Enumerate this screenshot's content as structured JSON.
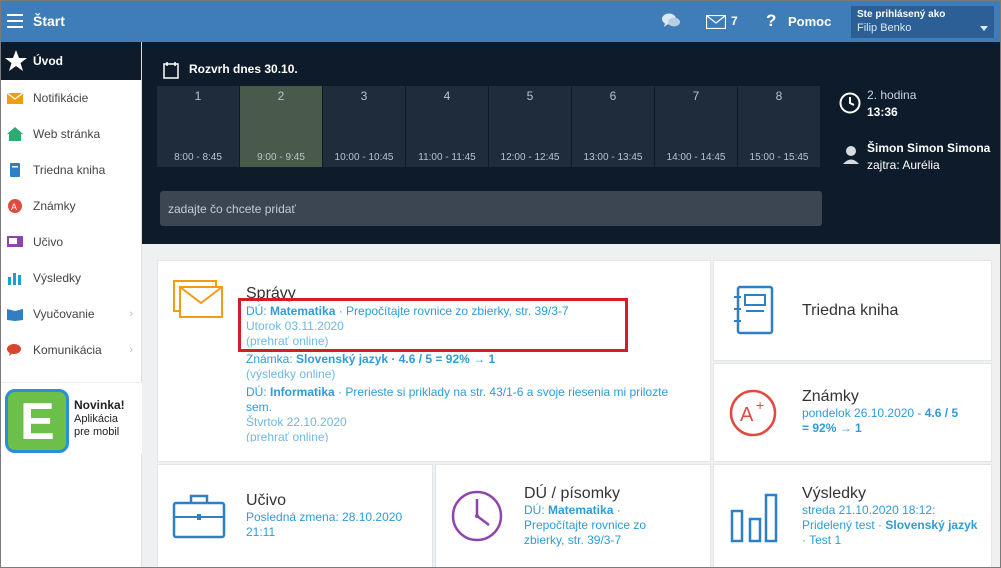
{
  "topbar": {
    "start_label": "Štart",
    "mail_count": "7",
    "help_label": "Pomoc",
    "logged_in_label": "Ste prihlásený ako",
    "user_name": "Filip Benko"
  },
  "sidebar": {
    "items": [
      {
        "label": "Úvod",
        "icon": "star-icon"
      },
      {
        "label": "Notifikácie",
        "icon": "envelope-icon"
      },
      {
        "label": "Web stránka",
        "icon": "home-icon"
      },
      {
        "label": "Triedna kniha",
        "icon": "book-icon"
      },
      {
        "label": "Známky",
        "icon": "grade-icon"
      },
      {
        "label": "Učivo",
        "icon": "curriculum-icon"
      },
      {
        "label": "Výsledky",
        "icon": "results-icon"
      },
      {
        "label": "Vyučovanie",
        "icon": "teaching-icon"
      },
      {
        "label": "Komunikácia",
        "icon": "communication-icon"
      }
    ],
    "promo": {
      "title": "Novinka!",
      "line1": "Aplikácia",
      "line2": "pre mobil",
      "logo_letter": "E"
    }
  },
  "schedule": {
    "title": "Rozvrh dnes 30.10.",
    "periods": [
      {
        "num": "1",
        "time": "8:00 - 8:45"
      },
      {
        "num": "2",
        "time": "9:00 - 9:45"
      },
      {
        "num": "3",
        "time": "10:00 - 10:45"
      },
      {
        "num": "4",
        "time": "11:00 - 11:45"
      },
      {
        "num": "5",
        "time": "12:00 - 12:45"
      },
      {
        "num": "6",
        "time": "13:00 - 13:45"
      },
      {
        "num": "7",
        "time": "14:00 - 14:45"
      },
      {
        "num": "8",
        "time": "15:00 - 15:45"
      }
    ],
    "current_period": "2",
    "current_hour": "2. hodina",
    "current_time": "13:36",
    "birthday_name": "Šimon Simon Simona",
    "birthday_next": "zajtra: Aurélia",
    "add_placeholder": "zadajte čo chcete pridať"
  },
  "messages": {
    "title": "Správy",
    "items": [
      {
        "prefix": "DÚ: ",
        "subject": "Matematika",
        "text": " · Prepočítajte rovnice zo zbierky, str. 39/3-7",
        "date": "Utorok 03.11.2020",
        "link": "(prehrať online)"
      },
      {
        "prefix": "Známka: ",
        "subject": "Slovenský jazyk",
        "text": " · 4.6 / 5 = 92% → 1",
        "date": "",
        "link": "(výsledky online)"
      },
      {
        "prefix": "DÚ: ",
        "subject": "Informatika",
        "text": " · Prerieste si priklady na str. 43/1-6 a svoje riesenia mi prilozte sem.",
        "date": "Štvrtok 22.10.2020",
        "link": "(prehrať online)"
      }
    ]
  },
  "class_book": {
    "title": "Triedna kniha"
  },
  "grades": {
    "title": "Známky",
    "line1": "pondelok 26.10.2020 - ",
    "line1_value": "4.6 / 5",
    "line2_value": "= 92% → 1"
  },
  "curriculum": {
    "title": "Učivo",
    "line1": "Posledná zmena: 28.10.2020",
    "line2": "21:11"
  },
  "homework": {
    "title": "DÚ / písomky",
    "prefix": "DÚ: ",
    "subject": "Matematika",
    "text": " · Prepočítajte rovnice zo zbierky, str. 39/3-7"
  },
  "results": {
    "title": "Výsledky",
    "line1": "streda 21.10.2020 18:12:",
    "line2": "Pridelený test · ",
    "subject": "Slovenský jazyk",
    "line3": " · Test 1"
  },
  "colors": {
    "topbar": "#3f7db8",
    "dark_band": "#0d1b2a",
    "link_blue": "#2f9bd8",
    "highlight_red": "#d41d2a"
  }
}
